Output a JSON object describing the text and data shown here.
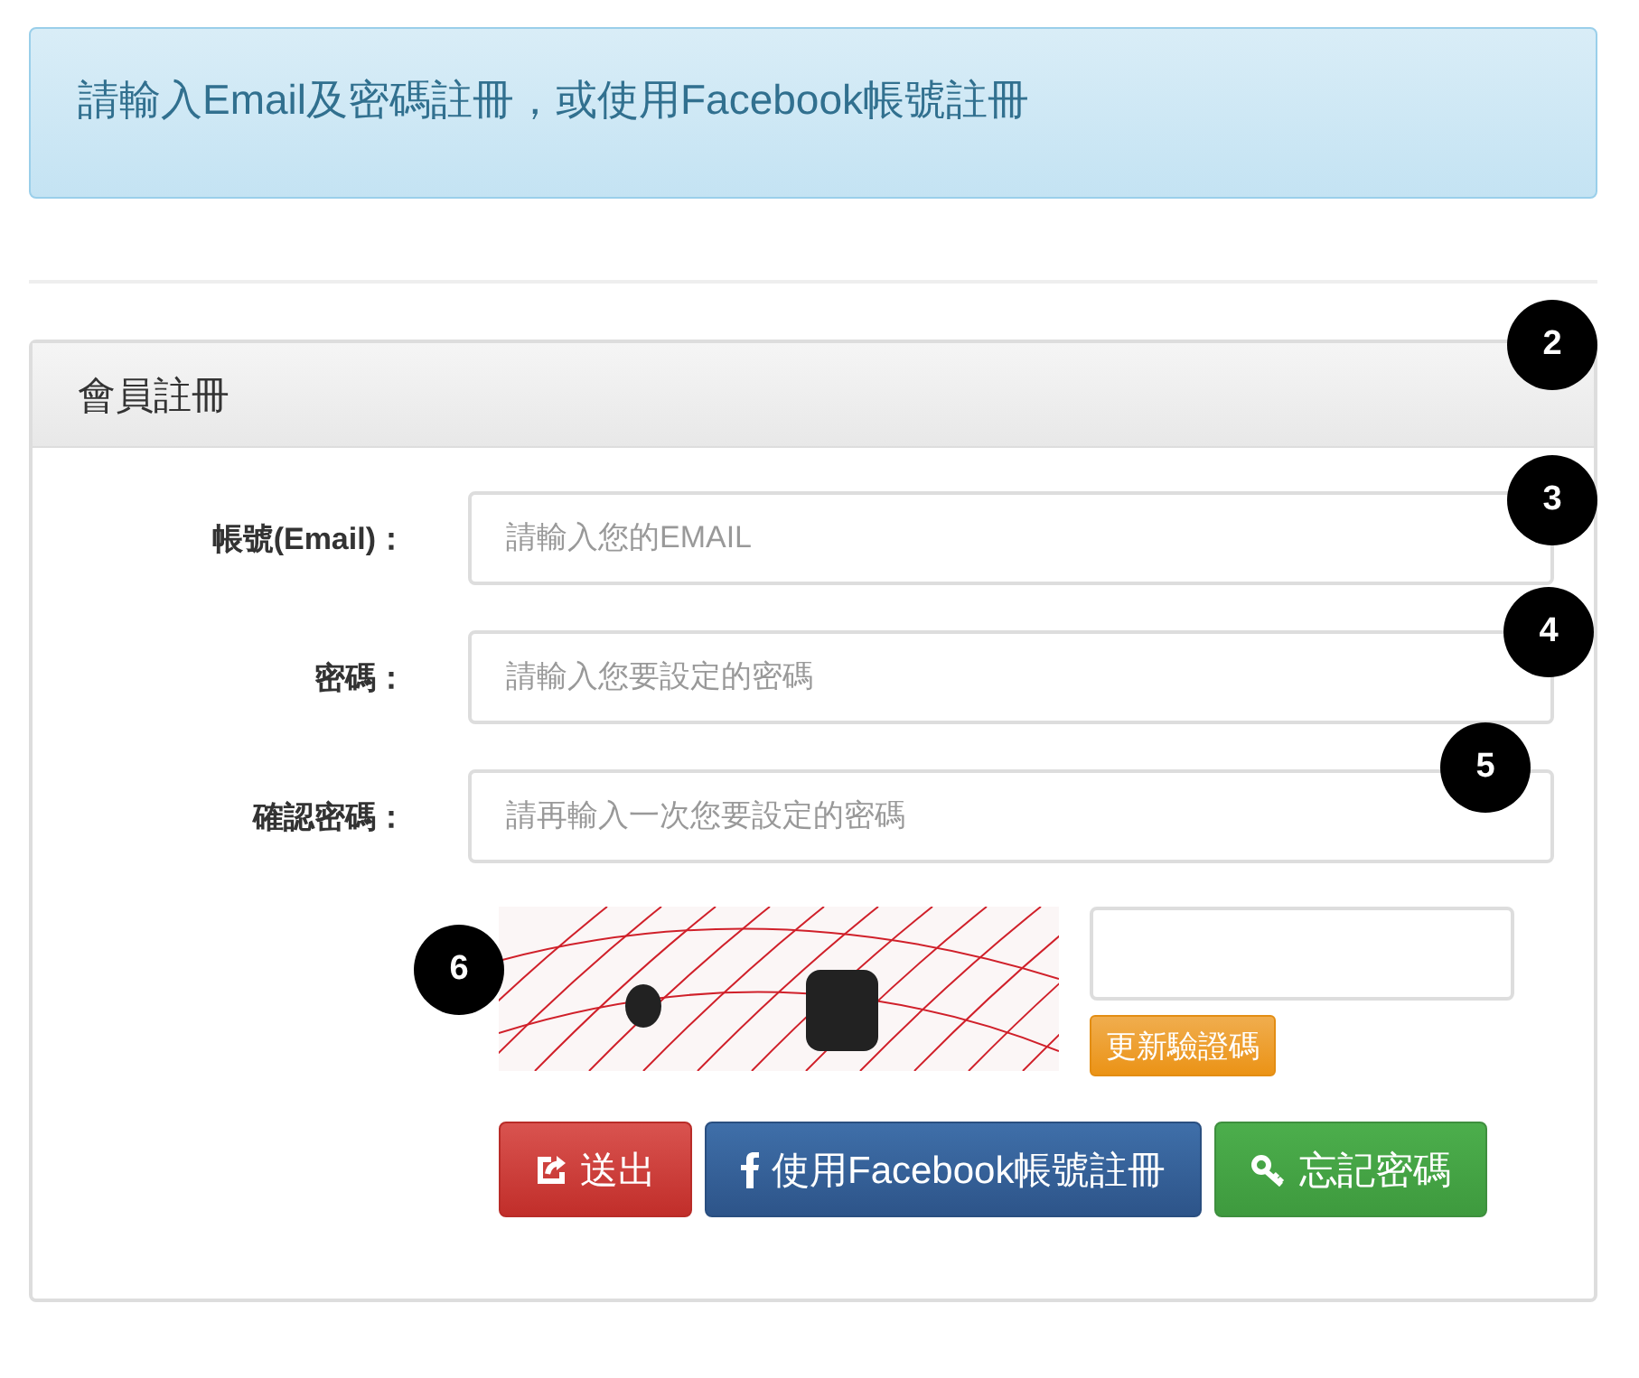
{
  "alert": {
    "text": "請輸入Email及密碼註冊，或使用Facebook帳號註冊"
  },
  "panel": {
    "title": "會員註冊",
    "fields": [
      {
        "label": "帳號(Email)：",
        "placeholder": "請輸入您的EMAIL"
      },
      {
        "label": "密碼：",
        "placeholder": "請輸入您要設定的密碼"
      },
      {
        "label": "確認密碼：",
        "placeholder": "請再輸入一次您要設定的密碼"
      }
    ],
    "captcha": {
      "kind": "picture",
      "refresh_button": "更新驗證碼"
    },
    "buttons": [
      {
        "label": "送出",
        "kind": "submit"
      },
      {
        "label": "使用Facebook帳號註冊",
        "kind": "facebook"
      },
      {
        "label": "忘記密碼",
        "kind": "forgot"
      }
    ]
  },
  "markers": [
    "2",
    "3",
    "4",
    "5",
    "6"
  ]
}
